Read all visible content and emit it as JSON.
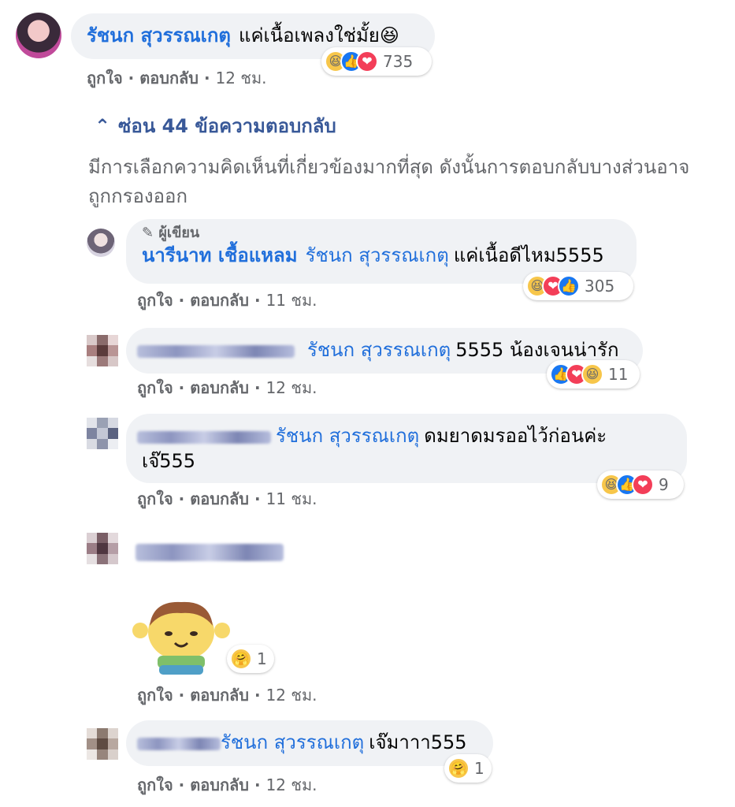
{
  "top_comment": {
    "name": "รัชนก สุวรรณเกตุ",
    "text": "แค่เนื้อเพลงใช่มั้ย😆",
    "reactions_count": "735",
    "like": "ถูกใจ",
    "reply": "ตอบกลับ",
    "time": "12 ชม."
  },
  "hide_replies": "ซ่อน 44 ข้อความตอบกลับ",
  "filter_note": "มีการเลือกความคิดเห็นที่เกี่ยวข้องมากที่สุด ดังนั้นการตอบกลับบางส่วนอาจถูกกรองออก",
  "replies": [
    {
      "author_badge": "ผู้เขียน",
      "name": "นารีนาท เชื้อแหลม",
      "tag": "รัชนก สุวรรณเกตุ",
      "text": "แค่เนื้อดีไหม5555",
      "reactions_count": "305",
      "like": "ถูกใจ",
      "reply": "ตอบกลับ",
      "time": "11 ชม."
    },
    {
      "tag": "รัชนก สุวรรณเกตุ",
      "text": "5555 น้องเจนน่ารัก",
      "reactions_count": "11",
      "like": "ถูกใจ",
      "reply": "ตอบกลับ",
      "time": "12 ชม."
    },
    {
      "tag": "รัชนก สุวรรณเกตุ",
      "text": "ดมยาดมรออไว้ก่อนค่ะ",
      "text2": "เจ๊555",
      "reactions_count": "9",
      "like": "ถูกใจ",
      "reply": "ตอบกลับ",
      "time": "11 ชม."
    },
    {
      "reactions_count": "1",
      "like": "ถูกใจ",
      "reply": "ตอบกลับ",
      "time": "12 ชม."
    },
    {
      "tag": "รัชนก สุวรรณเกตุ",
      "text": "เจ๊มาาา555",
      "reactions_count": "1",
      "like": "ถูกใจ",
      "reply": "ตอบกลับ",
      "time": "12 ชม."
    }
  ],
  "icons": {
    "haha": "😆",
    "like": "👍",
    "love": "❤",
    "care": "🤗",
    "pencil": "✎",
    "chevron": "⌃"
  },
  "separator": "·"
}
